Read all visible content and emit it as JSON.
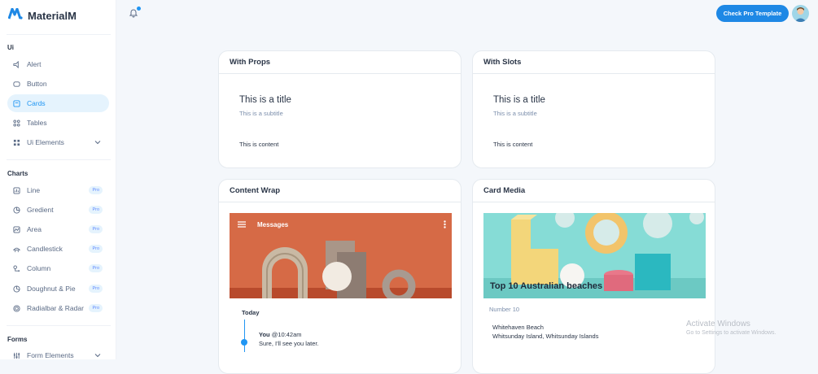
{
  "brand": {
    "name": "MaterialM",
    "logo_color": "#1e88e5"
  },
  "sidebar": {
    "sections": [
      {
        "label": "Ui"
      },
      {
        "label": "Charts"
      },
      {
        "label": "Forms"
      }
    ],
    "ui_items": [
      {
        "label": "Alert",
        "icon": "alert-icon"
      },
      {
        "label": "Button",
        "icon": "button-icon"
      },
      {
        "label": "Cards",
        "icon": "cards-icon",
        "active": true
      },
      {
        "label": "Tables",
        "icon": "tables-icon"
      },
      {
        "label": "Ui Elements",
        "icon": "ui-elements-icon",
        "has_children": true
      }
    ],
    "chart_items": [
      {
        "label": "Line",
        "icon": "line-chart-icon",
        "badge": "Pro"
      },
      {
        "label": "Gredient",
        "icon": "gradient-chart-icon",
        "badge": "Pro"
      },
      {
        "label": "Area",
        "icon": "area-chart-icon",
        "badge": "Pro"
      },
      {
        "label": "Candlestick",
        "icon": "candlestick-icon",
        "badge": "Pro"
      },
      {
        "label": "Column",
        "icon": "column-chart-icon",
        "badge": "Pro"
      },
      {
        "label": "Doughnut & Pie",
        "icon": "pie-chart-icon",
        "badge": "Pro"
      },
      {
        "label": "Radialbar & Radar",
        "icon": "radar-icon",
        "badge": "Pro"
      }
    ],
    "form_items": [
      {
        "label": "Form Elements",
        "icon": "form-elements-icon",
        "has_children": true
      }
    ]
  },
  "topbar": {
    "pro_button": "Check Pro Template",
    "accent": "#1e88e5"
  },
  "cards": {
    "with_props": {
      "header": "With Props",
      "title": "This is a title",
      "subtitle": "This is a subtitle",
      "content": "This is content"
    },
    "with_slots": {
      "header": "With Slots",
      "title": "This is a title",
      "subtitle": "This is a subtitle",
      "content": "This is content"
    },
    "content_wrap": {
      "header": "Content Wrap",
      "media_title": "Messages",
      "today": "Today",
      "message_from": "You",
      "message_time": "@10:42am",
      "message_text": "Sure, I'll see you later."
    },
    "card_media": {
      "header": "Card Media",
      "media_title": "Top 10 Australian beaches",
      "number": "Number 10",
      "address_1": "Whitehaven Beach",
      "address_2": "Whitsunday Island, Whitsunday Islands"
    }
  },
  "watermark": {
    "line1": "Activate Windows",
    "line2": "Go to Settings to activate Windows."
  }
}
